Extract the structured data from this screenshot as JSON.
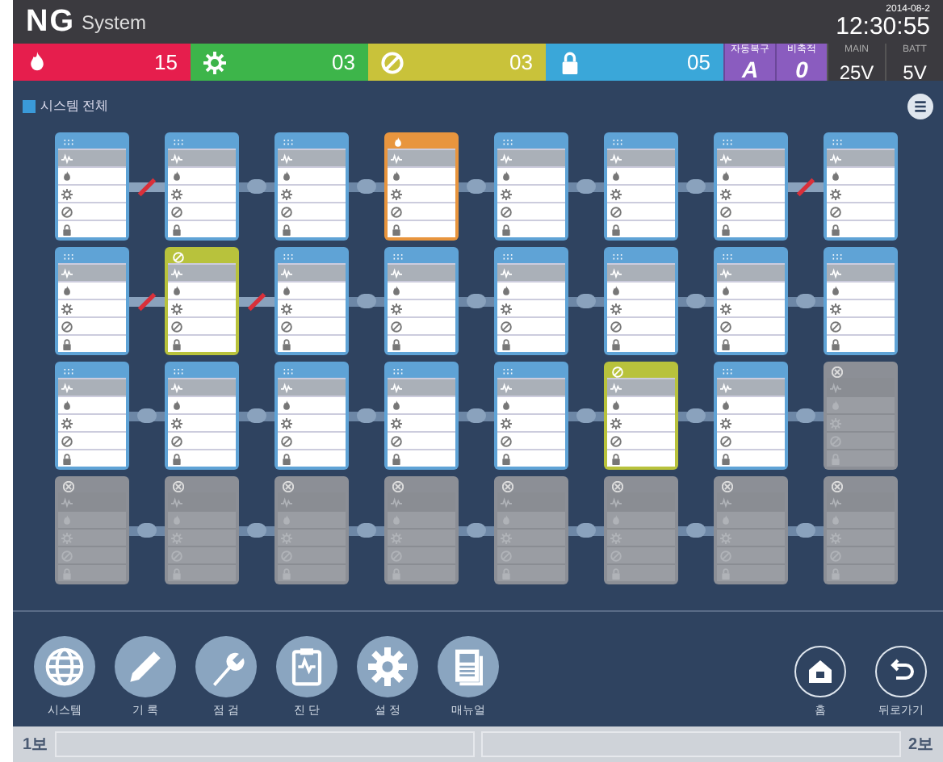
{
  "header": {
    "logo": "NG",
    "title": "System",
    "date": "2014-08-2",
    "time": "12:30:55"
  },
  "status_bar": {
    "counters": [
      {
        "kind": "fire",
        "count": "15"
      },
      {
        "kind": "trouble",
        "count": "03"
      },
      {
        "kind": "disabled",
        "count": "03"
      },
      {
        "kind": "lock",
        "count": "05"
      }
    ],
    "modes": [
      {
        "label": "자동복구",
        "value": "A"
      },
      {
        "label": "비축적",
        "value": "0"
      }
    ],
    "power": [
      {
        "label": "MAIN",
        "value": "25V"
      },
      {
        "label": "BATT",
        "value": "5V"
      }
    ]
  },
  "section_title": "시스템 전체",
  "module_rows": [
    {
      "modules": [
        {
          "kind": "normal"
        },
        {
          "kind": "normal"
        },
        {
          "kind": "normal"
        },
        {
          "kind": "alarm"
        },
        {
          "kind": "normal"
        },
        {
          "kind": "normal"
        },
        {
          "kind": "normal"
        },
        {
          "kind": "normal"
        }
      ],
      "links": [
        {
          "broken": true
        },
        {
          "broken": false
        },
        {
          "broken": false
        },
        {
          "broken": false
        },
        {
          "broken": false
        },
        {
          "broken": false
        },
        {
          "broken": true
        }
      ]
    },
    {
      "modules": [
        {
          "kind": "normal"
        },
        {
          "kind": "warning"
        },
        {
          "kind": "normal"
        },
        {
          "kind": "normal"
        },
        {
          "kind": "normal"
        },
        {
          "kind": "normal"
        },
        {
          "kind": "normal"
        },
        {
          "kind": "normal"
        }
      ],
      "links": [
        {
          "broken": true
        },
        {
          "broken": true
        },
        {
          "broken": false
        },
        {
          "broken": false
        },
        {
          "broken": false
        },
        {
          "broken": false
        },
        {
          "broken": false
        }
      ]
    },
    {
      "modules": [
        {
          "kind": "normal"
        },
        {
          "kind": "normal"
        },
        {
          "kind": "normal"
        },
        {
          "kind": "normal"
        },
        {
          "kind": "normal"
        },
        {
          "kind": "warning"
        },
        {
          "kind": "normal"
        },
        {
          "kind": "offline"
        }
      ],
      "links": [
        {
          "broken": false
        },
        {
          "broken": false
        },
        {
          "broken": false
        },
        {
          "broken": false
        },
        {
          "broken": false
        },
        {
          "broken": false
        },
        {
          "broken": false
        }
      ]
    },
    {
      "modules": [
        {
          "kind": "offline"
        },
        {
          "kind": "offline"
        },
        {
          "kind": "offline"
        },
        {
          "kind": "offline"
        },
        {
          "kind": "offline"
        },
        {
          "kind": "offline"
        },
        {
          "kind": "offline"
        },
        {
          "kind": "offline"
        }
      ],
      "links": [
        {
          "broken": false
        },
        {
          "broken": false
        },
        {
          "broken": false
        },
        {
          "broken": false
        },
        {
          "broken": false
        },
        {
          "broken": false
        },
        {
          "broken": false
        }
      ]
    }
  ],
  "nav": [
    {
      "kind": "globe",
      "label": "시스템"
    },
    {
      "kind": "pencil",
      "label": "기 록"
    },
    {
      "kind": "wrench",
      "label": "점 검"
    },
    {
      "kind": "clipboard",
      "label": "진 단"
    },
    {
      "kind": "gear",
      "label": "설 정"
    },
    {
      "kind": "manual",
      "label": "매뉴얼"
    }
  ],
  "nav_right": [
    {
      "kind": "home",
      "label": "홈"
    },
    {
      "kind": "back",
      "label": "뒤로가기"
    }
  ],
  "timeline": {
    "start": "1보",
    "end": "2보"
  }
}
